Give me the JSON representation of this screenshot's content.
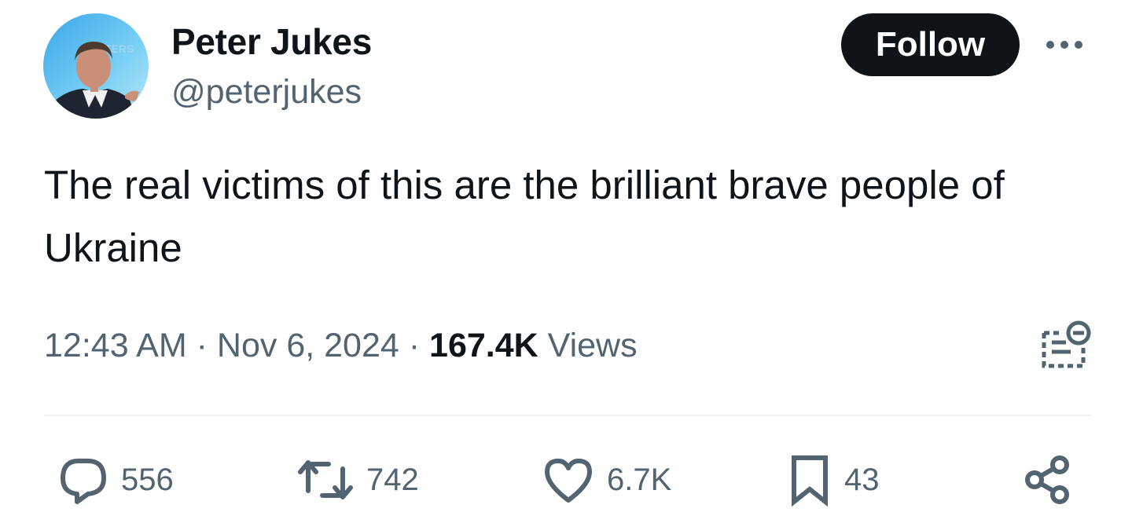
{
  "author": {
    "name": "Peter Jukes",
    "handle": "@peterjukes",
    "avatar_backdrop_text": "TERS"
  },
  "follow_label": "Follow",
  "tweet": {
    "text": "The real victims of this are the brilliant brave people of Ukraine",
    "time": "12:43 AM",
    "separator": "·",
    "date": "Nov 6, 2024",
    "views_count": "167.4K",
    "views_label": "Views"
  },
  "actions": {
    "replies": "556",
    "retweets": "742",
    "likes": "6.7K",
    "bookmarks": "43"
  },
  "icons": {
    "more": "more-horizontal-icon",
    "analytics": "analytics-icon",
    "reply": "reply-icon",
    "retweet": "retweet-icon",
    "like": "heart-icon",
    "bookmark": "bookmark-icon",
    "share": "share-icon"
  },
  "colors": {
    "text_primary": "#0f1419",
    "text_secondary": "#536471",
    "follow_bg": "#0f1419",
    "follow_text": "#ffffff",
    "divider": "#eff3f4"
  }
}
